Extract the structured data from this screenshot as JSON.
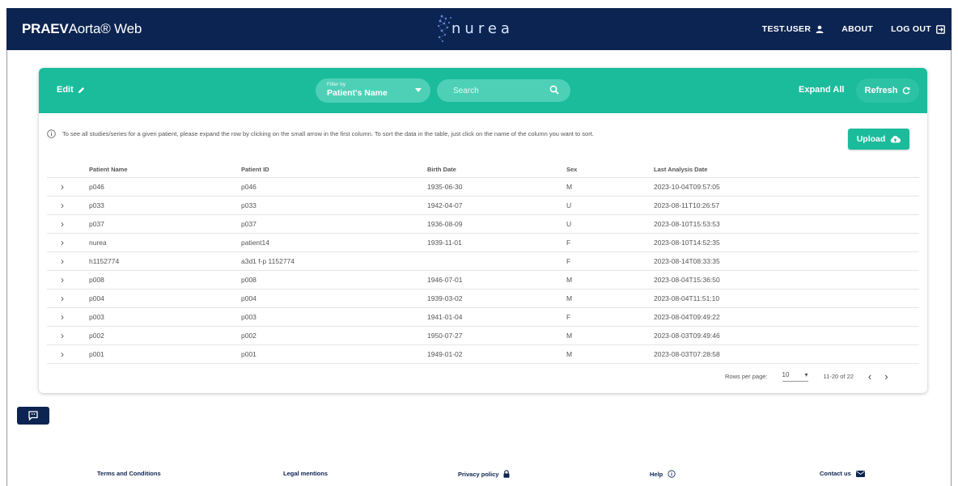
{
  "app": {
    "brand_bold": "PRAEV",
    "brand_rest": "Aorta® Web",
    "logo_text": "nurea"
  },
  "topnav": {
    "user": "TEST.USER",
    "about": "ABOUT",
    "logout": "LOG OUT"
  },
  "toolbar": {
    "edit_label": "Edit",
    "filter_label": "Filter by",
    "filter_value": "Patient's Name",
    "search_placeholder": "Search",
    "expand_all": "Expand All",
    "refresh": "Refresh"
  },
  "info_text": "To see all studies/series for a given patient, please expand the row by clicking on the small arrow in the first column. To sort the data in the table, just click on the name of the column you want to sort.",
  "upload_label": "Upload",
  "table": {
    "columns": [
      "Patient Name",
      "Patient ID",
      "Birth Date",
      "Sex",
      "Last Analysis Date"
    ],
    "rows": [
      {
        "name": "p046",
        "id": "p046",
        "birth": "1935-06-30",
        "sex": "M",
        "last": "2023-10-04T09:57:05"
      },
      {
        "name": "p033",
        "id": "p033",
        "birth": "1942-04-07",
        "sex": "U",
        "last": "2023-08-11T10:26:57"
      },
      {
        "name": "p037",
        "id": "p037",
        "birth": "1936-08-09",
        "sex": "U",
        "last": "2023-08-10T15:53:53"
      },
      {
        "name": "nurea",
        "id": "patient14",
        "birth": "1939-11-01",
        "sex": "F",
        "last": "2023-08-10T14:52:35"
      },
      {
        "name": "h1152774",
        "id": "a3d1 f-p 1152774",
        "birth": "",
        "sex": "F",
        "last": "2023-08-14T08:33:35"
      },
      {
        "name": "p008",
        "id": "p008",
        "birth": "1946-07-01",
        "sex": "M",
        "last": "2023-08-04T15:36:50"
      },
      {
        "name": "p004",
        "id": "p004",
        "birth": "1939-03-02",
        "sex": "M",
        "last": "2023-08-04T11:51:10"
      },
      {
        "name": "p003",
        "id": "p003",
        "birth": "1941-01-04",
        "sex": "F",
        "last": "2023-08-04T09:49:22"
      },
      {
        "name": "p002",
        "id": "p002",
        "birth": "1950-07-27",
        "sex": "M",
        "last": "2023-08-03T09:49:46"
      },
      {
        "name": "p001",
        "id": "p001",
        "birth": "1949-01-02",
        "sex": "M",
        "last": "2023-08-03T07:28:58"
      }
    ]
  },
  "pagination": {
    "rows_per_page_label": "Rows per page:",
    "rows_per_page": "10",
    "range": "11-20 of 22"
  },
  "footer": {
    "terms": "Terms and Conditions",
    "legal": "Legal mentions",
    "privacy": "Privacy policy",
    "help": "Help",
    "contact": "Contact us"
  },
  "colors": {
    "navy": "#0c2451",
    "teal": "#1abc9c"
  },
  "icons": {
    "user": "user-icon",
    "logout": "logout-icon",
    "edit": "pencil-icon",
    "search": "search-icon",
    "refresh": "refresh-icon",
    "info": "info-icon",
    "upload": "cloud-upload-icon",
    "feedback": "feedback-icon",
    "privacy": "lock-icon",
    "help": "info-icon",
    "contact": "mail-icon"
  }
}
